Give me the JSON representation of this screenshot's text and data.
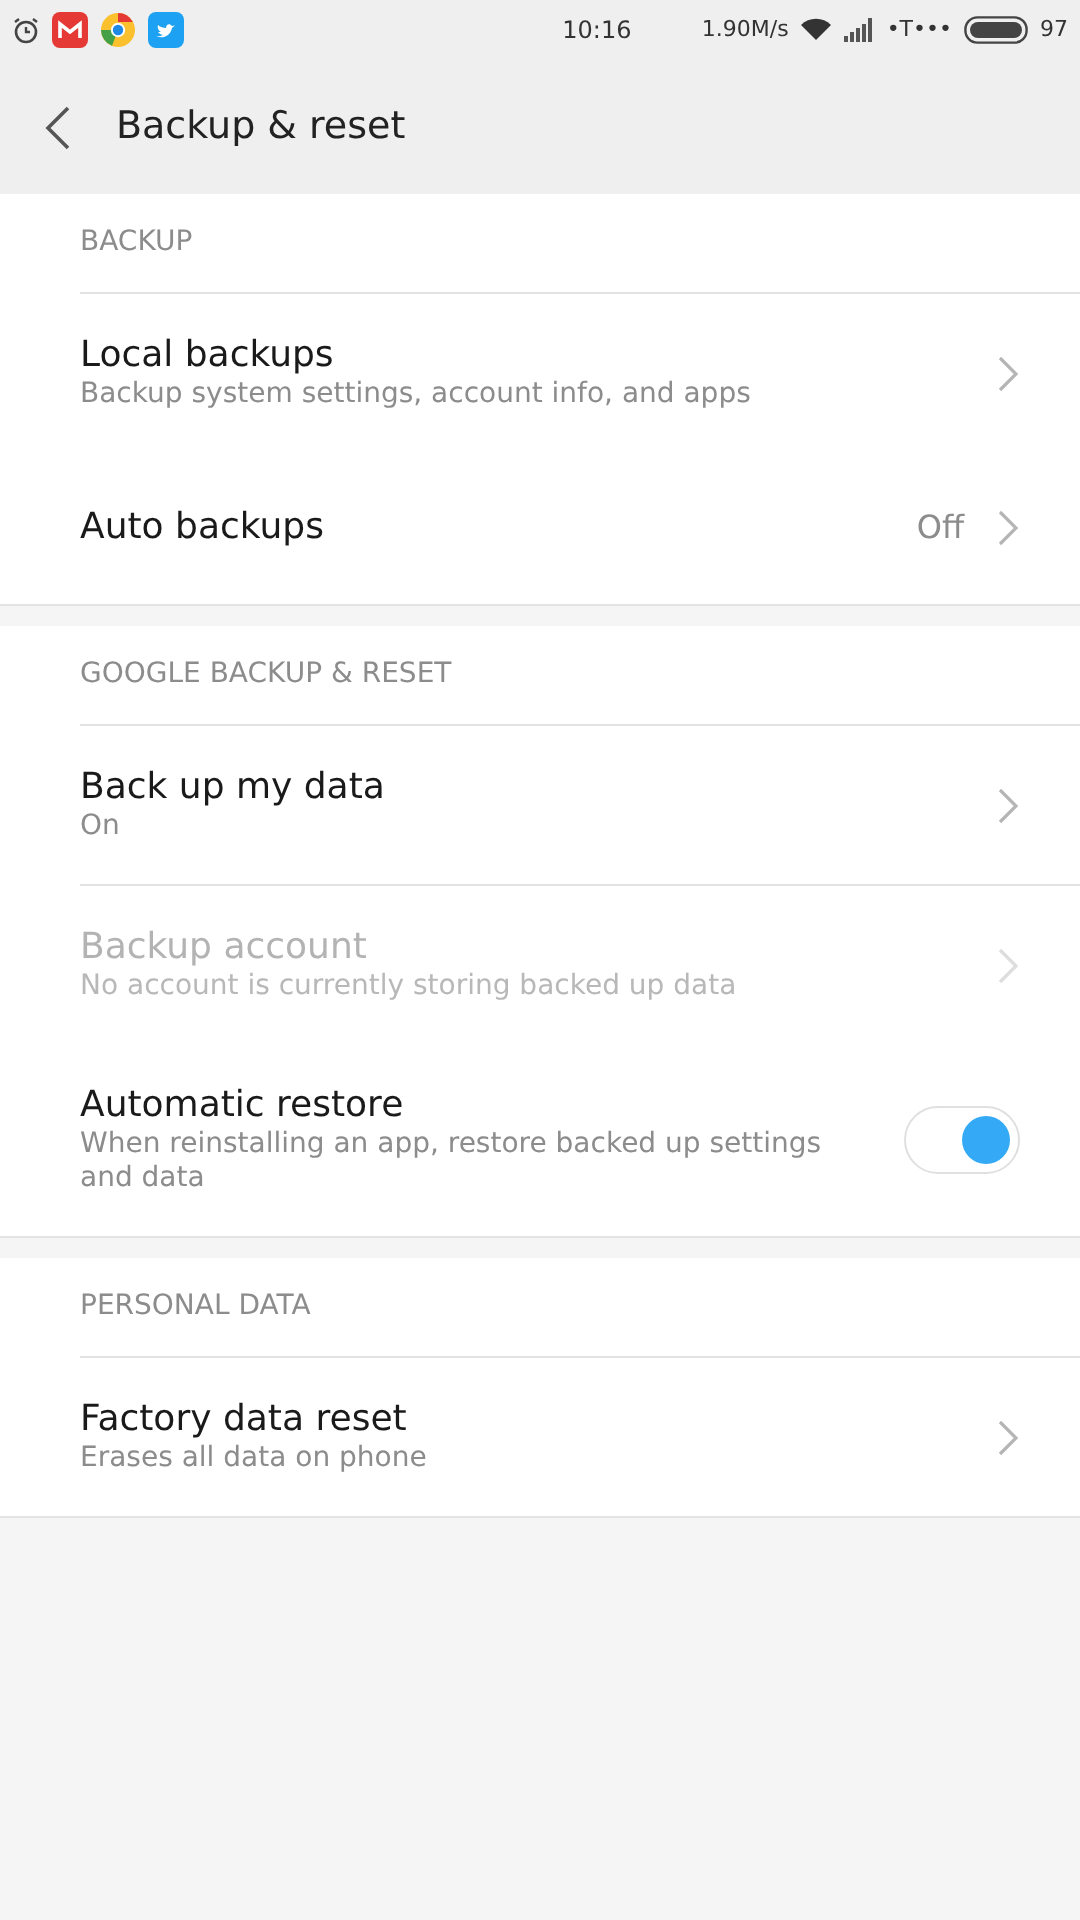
{
  "status_bar": {
    "time": "10:16",
    "speed": "1.90M/s",
    "carrier": "•T•••",
    "battery": "97"
  },
  "header": {
    "title": "Backup & reset"
  },
  "sections": [
    {
      "title": "BACKUP",
      "items": [
        {
          "kind": "nav",
          "title": "Local backups",
          "subtitle": "Backup system settings, account info, and apps",
          "disabled": false,
          "divider_below": false
        },
        {
          "kind": "value",
          "title": "Auto backups",
          "value": "Off",
          "disabled": false,
          "divider_below": false
        }
      ]
    },
    {
      "title": "GOOGLE BACKUP & RESET",
      "items": [
        {
          "kind": "nav",
          "title": "Back up my data",
          "subtitle": "On",
          "disabled": false,
          "divider_below": true
        },
        {
          "kind": "nav",
          "title": "Backup account",
          "subtitle": "No account is currently storing backed up data",
          "disabled": true,
          "divider_below": false
        },
        {
          "kind": "toggle",
          "title": "Automatic restore",
          "subtitle": "When reinstalling an app, restore backed up settings and data",
          "on": true,
          "disabled": false,
          "divider_below": false
        }
      ]
    },
    {
      "title": "PERSONAL DATA",
      "items": [
        {
          "kind": "nav",
          "title": "Factory data reset",
          "subtitle": "Erases all data on phone",
          "disabled": false,
          "divider_below": false
        }
      ]
    }
  ]
}
